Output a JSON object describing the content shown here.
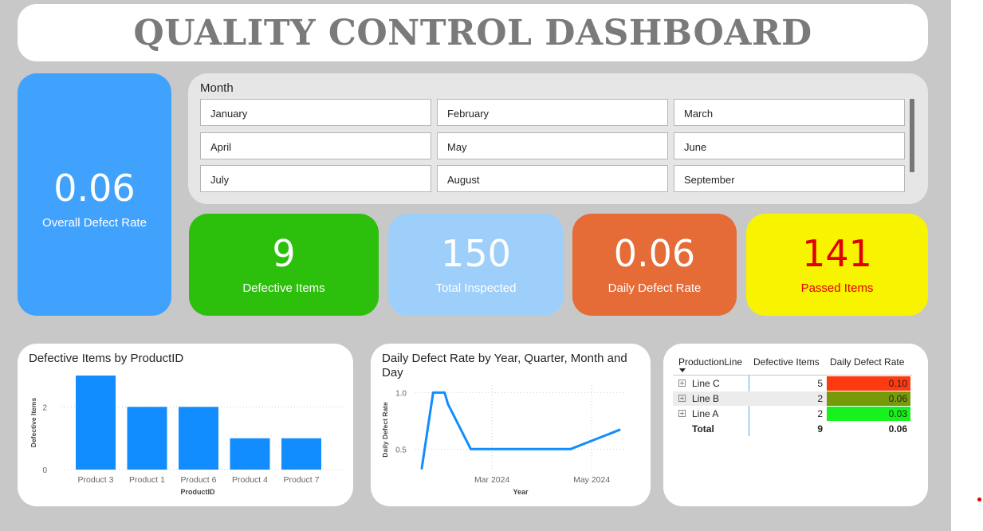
{
  "title": "QUALITY CONTROL DASHBOARD",
  "kpis": {
    "overall": {
      "value": "0.06",
      "label": "Overall Defect Rate"
    },
    "defective": {
      "value": "9",
      "label": "Defective Items"
    },
    "total": {
      "value": "150",
      "label": "Total Inspected"
    },
    "daily": {
      "value": "0.06",
      "label": "Daily Defect Rate"
    },
    "passed": {
      "value": "141",
      "label": "Passed Items"
    }
  },
  "slicer": {
    "title": "Month",
    "items": [
      "January",
      "February",
      "March",
      "April",
      "May",
      "June",
      "July",
      "August",
      "September"
    ]
  },
  "bar_panel": {
    "title": "Defective Items by ProductID"
  },
  "line_panel": {
    "title_line1": "Daily Defect Rate by Year, Quarter, Month and",
    "title_line2": "Day"
  },
  "table": {
    "headers": [
      "ProductionLine",
      "Defective Items",
      "Daily Defect Rate"
    ],
    "rows": [
      {
        "line": "Line C",
        "items": "5",
        "rate": "0.10",
        "color": "#fd3a10"
      },
      {
        "line": "Line B",
        "items": "2",
        "rate": "0.06",
        "color": "#779a0a"
      },
      {
        "line": "Line A",
        "items": "2",
        "rate": "0.03",
        "color": "#17f21e"
      }
    ],
    "total": {
      "label": "Total",
      "items": "9",
      "rate": "0.06"
    },
    "expand_icon": "plus-box-icon",
    "sort_icon": "sort-down-icon"
  },
  "colors": {
    "bar": "#118dff",
    "line": "#118dff"
  },
  "chart_data": [
    {
      "type": "bar",
      "title": "Defective Items by ProductID",
      "categories": [
        "Product 3",
        "Product 1",
        "Product 6",
        "Product 4",
        "Product 7"
      ],
      "values": [
        3,
        2,
        2,
        1,
        1
      ],
      "xlabel": "ProductID",
      "ylabel": "Defective Items",
      "yticks": [
        "0",
        "2"
      ],
      "ylim": [
        0,
        3
      ]
    },
    {
      "type": "line",
      "title": "Daily Defect Rate by Year, Quarter, Month and Day",
      "x": [
        "2024-01-18",
        "2024-01-25",
        "2024-02-01",
        "2024-02-03",
        "2024-02-17",
        "2024-04-18",
        "2024-05-18"
      ],
      "values": [
        0.33,
        1.0,
        1.0,
        0.9,
        0.5,
        0.5,
        0.67
      ],
      "xlabel": "Year",
      "ylabel": "Daily Defect Rate",
      "xticks": [
        "Mar 2024",
        "May 2024"
      ],
      "yticks": [
        "0.5",
        "1.0"
      ],
      "ylim": [
        0.27,
        1.08
      ]
    }
  ]
}
